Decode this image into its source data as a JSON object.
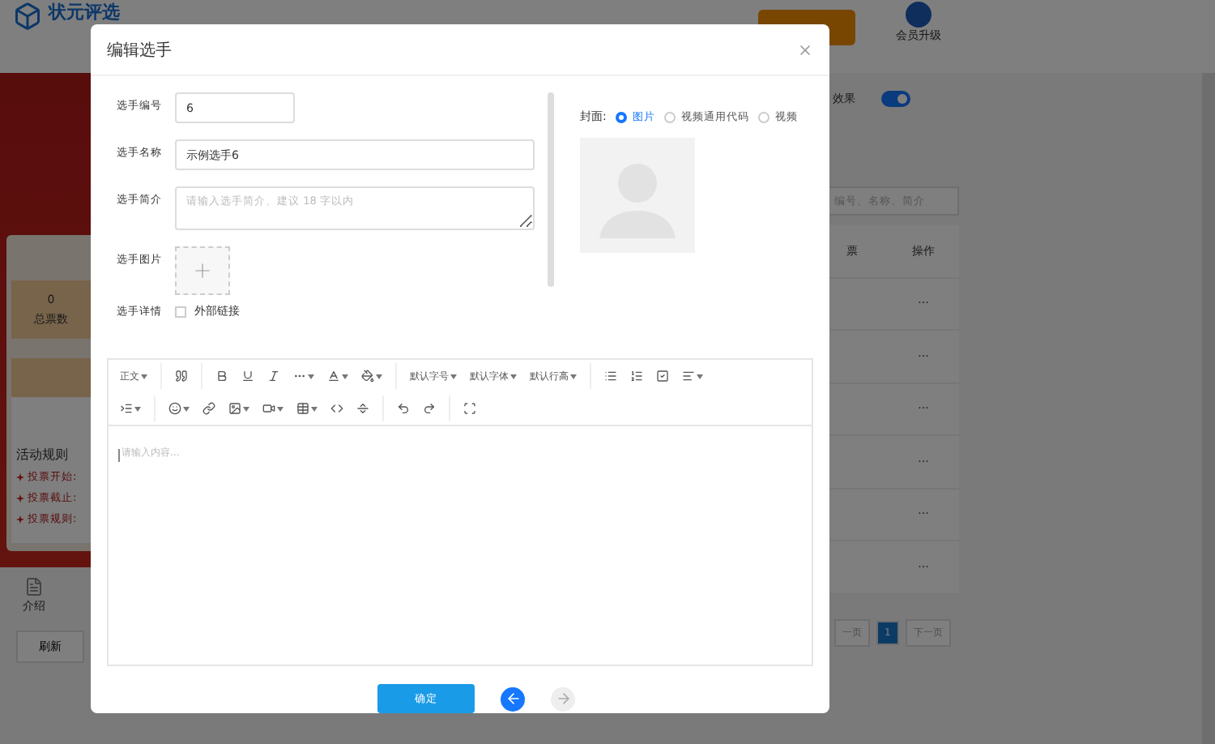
{
  "background": {
    "logo": "状元评选",
    "member_upgrade": "会员升级",
    "toggle": {
      "label": "效果",
      "on": true
    },
    "search": {
      "placeholder": "编号、名称、简介"
    },
    "stats": {
      "value": "0",
      "label": "总票数"
    },
    "rules": {
      "title": "活动规则",
      "items": [
        "投票开始:",
        "投票截止:",
        "投票规则:"
      ]
    },
    "intro": "介绍",
    "refresh": "刷新",
    "table": {
      "columns": [
        "票",
        "操作"
      ],
      "rows": [
        {
          "action": "···"
        },
        {
          "action": "···"
        },
        {
          "action": "···"
        },
        {
          "action": "···"
        },
        {
          "action": "···"
        },
        {
          "action": "···"
        }
      ]
    },
    "pagination": {
      "prev": "一页",
      "pages": [
        {
          "label": "1",
          "selected": true
        }
      ],
      "next": "下一页"
    }
  },
  "dialog": {
    "title": "编辑选手",
    "fields": [
      {
        "kind": "text",
        "label": "选手编号",
        "value": "6"
      },
      {
        "kind": "wide",
        "label": "选手名称",
        "value": "示例选手6"
      },
      {
        "kind": "textarea",
        "label": "选手简介",
        "placeholder": "请输入选手简介、建议 18 字以内"
      },
      {
        "kind": "upload",
        "label": "选手图片"
      },
      {
        "kind": "detail",
        "label": "选手详情",
        "checkbox": {
          "label": "外部链接",
          "checked": false
        }
      }
    ],
    "cover": {
      "label": "封面:",
      "options": [
        {
          "label": "图片",
          "selected": true
        },
        {
          "label": "视频通用代码",
          "selected": false
        },
        {
          "label": "视频",
          "selected": false
        }
      ]
    },
    "editor": {
      "toolbar_labels": [
        "正文",
        "默认字号",
        "默认字体",
        "默认行高"
      ],
      "placeholder": "请输入内容..."
    },
    "confirm": "确定"
  }
}
